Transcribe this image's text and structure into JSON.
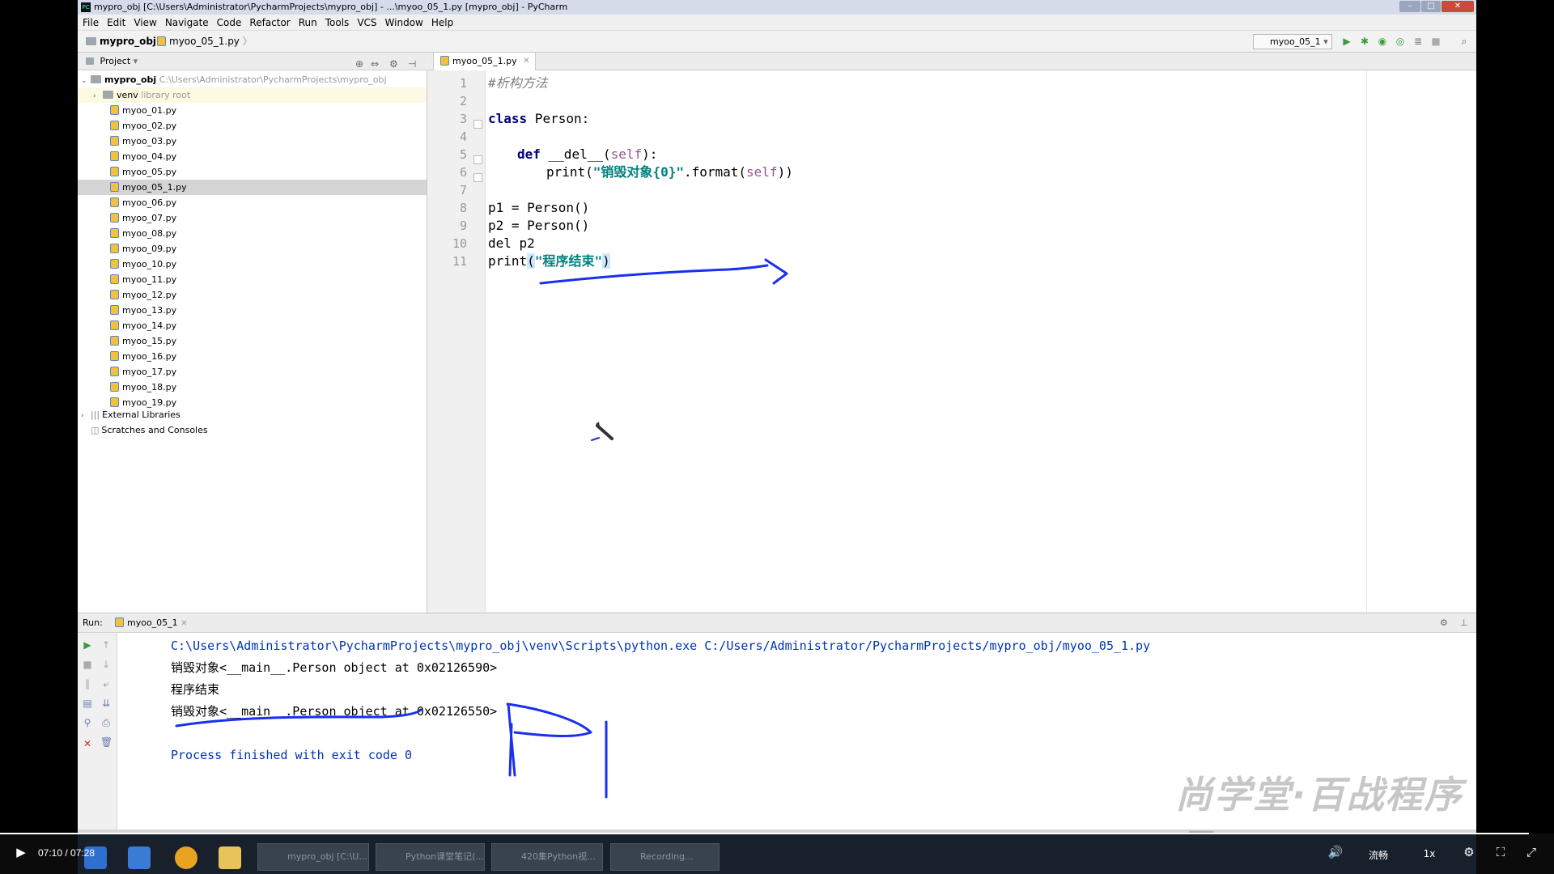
{
  "window": {
    "title": "mypro_obj [C:\\Users\\Administrator\\PycharmProjects\\mypro_obj] - ...\\myoo_05_1.py [mypro_obj] - PyCharm"
  },
  "menu": [
    "File",
    "Edit",
    "View",
    "Navigate",
    "Code",
    "Refactor",
    "Run",
    "Tools",
    "VCS",
    "Window",
    "Help"
  ],
  "navbar": {
    "project": "mypro_obj",
    "file": "myoo_05_1.py",
    "run_config": "myoo_05_1"
  },
  "project_panel": {
    "header": "Project",
    "root_name": "mypro_obj",
    "root_path": "C:\\Users\\Administrator\\PycharmProjects\\mypro_obj",
    "venv_name": "venv",
    "venv_note": "library root",
    "files": [
      "myoo_01.py",
      "myoo_02.py",
      "myoo_03.py",
      "myoo_04.py",
      "myoo_05.py",
      "myoo_05_1.py",
      "myoo_06.py",
      "myoo_07.py",
      "myoo_08.py",
      "myoo_09.py",
      "myoo_10.py",
      "myoo_11.py",
      "myoo_12.py",
      "myoo_13.py",
      "myoo_14.py",
      "myoo_15.py",
      "myoo_16.py",
      "myoo_17.py",
      "myoo_18.py",
      "myoo_19.py"
    ],
    "selected_file": "myoo_05_1.py",
    "external": "External Libraries",
    "scratches": "Scratches and Consoles"
  },
  "editor": {
    "tab": "myoo_05_1.py",
    "line_numbers": [
      "1",
      "2",
      "3",
      "4",
      "5",
      "6",
      "7",
      "8",
      "9",
      "10",
      "11"
    ],
    "code": {
      "l1": "#析构方法",
      "l3_kw": "class",
      "l3_rest": " Person:",
      "l5_kw": "def",
      "l5_name": " __del__(",
      "l5_self": "self",
      "l5_end": "):",
      "l6_a": "print(",
      "l6_str": "\"销毁对象{0}\"",
      "l6_b": ".format(",
      "l6_self": "self",
      "l6_c": "))",
      "l8": "p1 = Person()",
      "l9": "p2 = Person()",
      "l10": "del p2",
      "l11_a": "print",
      "l11_b": "(",
      "l11_str": "\"程序结束\"",
      "l11_c": ")"
    }
  },
  "run_panel": {
    "label": "Run:",
    "tab": "myoo_05_1",
    "output": [
      "C:\\Users\\Administrator\\PycharmProjects\\mypro_obj\\venv\\Scripts\\python.exe C:/Users/Administrator/PycharmProjects/mypro_obj/myoo_05_1.py",
      "销毁对象<__main__.Person object at 0x02126590>",
      "程序结束",
      "销毁对象<__main__.Person object at 0x02126550>",
      "",
      "Process finished with exit code 0"
    ]
  },
  "watermark": "尚学堂·百战程序员",
  "taskbar": [
    {
      "label": "mypro_obj [C:\\U..."
    },
    {
      "label": "Python课堂笔记(..."
    },
    {
      "label": "420集Python视..."
    },
    {
      "label": "Recording..."
    }
  ],
  "video": {
    "time": "07:10 / 07:28",
    "progress": 0.984,
    "quality": "流畅",
    "speed": "1x"
  },
  "colors": {
    "keyword": "#000080",
    "string": "#008080",
    "comment": "#808080",
    "console_path": "#0033b3",
    "annotation": "#1a2ff0"
  }
}
